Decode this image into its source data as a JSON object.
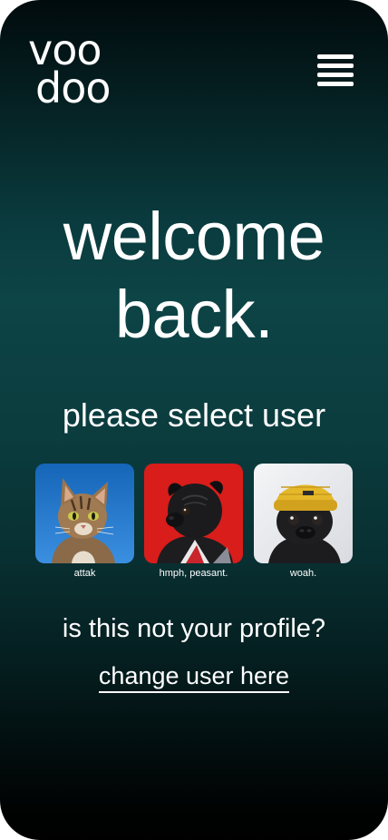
{
  "brand": {
    "logo_line1": "voo",
    "logo_line2": "doo"
  },
  "header": {
    "menu_icon": "hamburger-menu-icon"
  },
  "main": {
    "heading_line1": "welcome",
    "heading_line2": "back.",
    "select_prompt": "please select user",
    "users": [
      {
        "name": "attak",
        "avatar": "tabby-cat-avatar"
      },
      {
        "name": "hmph, peasant.",
        "avatar": "pug-red-background-avatar"
      },
      {
        "name": "woah.",
        "avatar": "pug-yellow-beanie-avatar"
      }
    ],
    "not_profile_text": "is this not your profile?",
    "change_user_link": "change user here"
  },
  "colors": {
    "background_top": "#010b0d",
    "background_mid": "#0d4446",
    "background_bottom": "#000000",
    "text": "#ffffff"
  }
}
